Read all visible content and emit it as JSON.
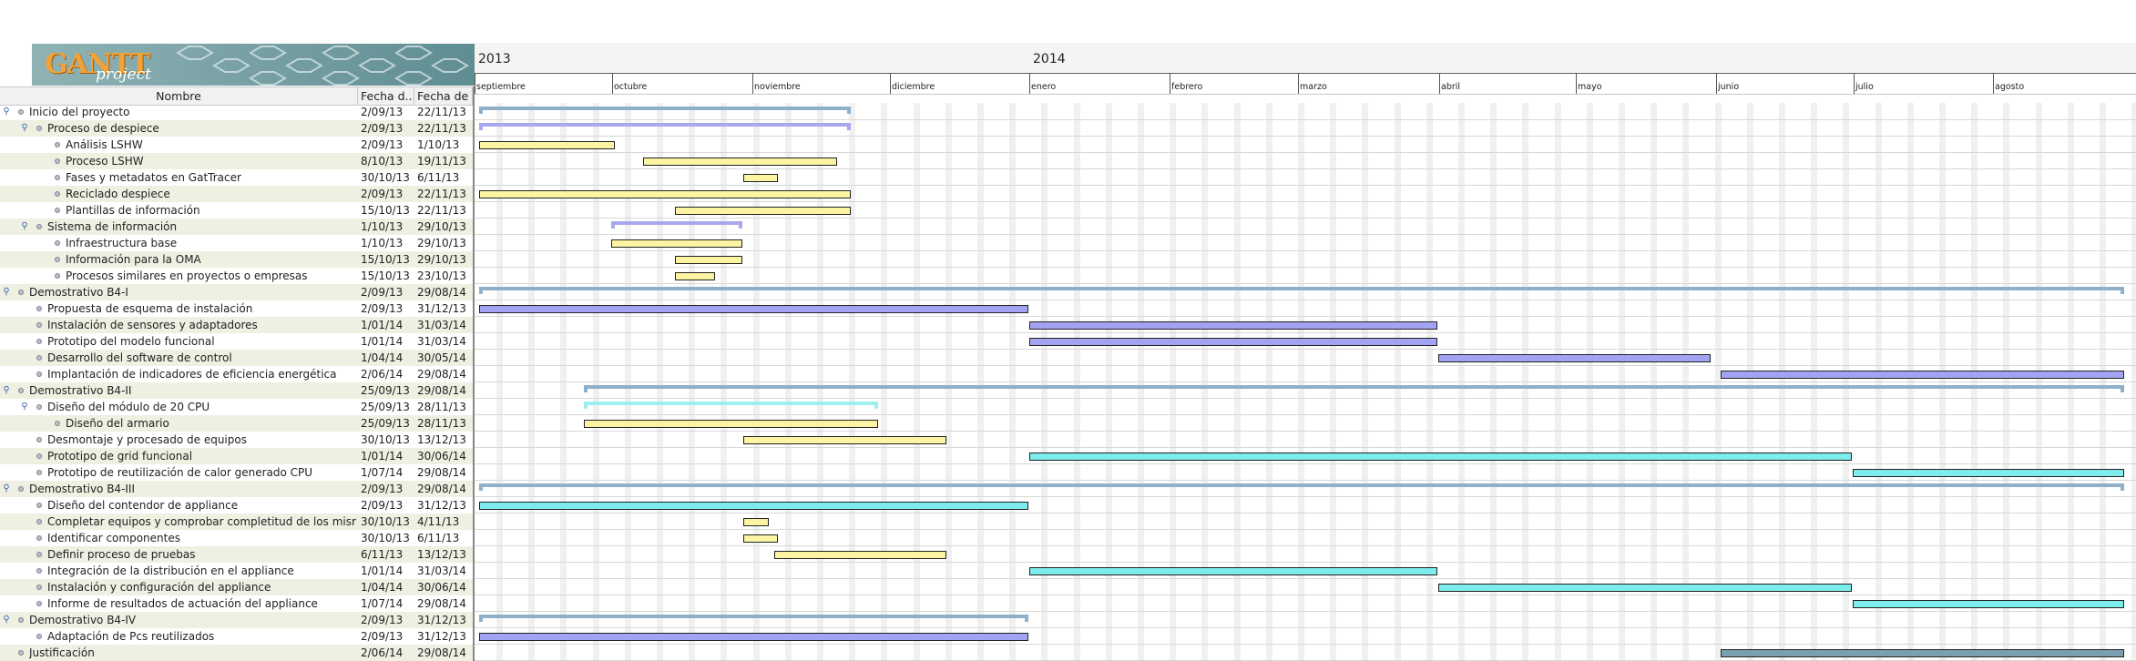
{
  "colors": {
    "yellow": "#fbf4a3",
    "purple": "#a3a3f4",
    "cyan": "#7cecec",
    "steel": "#7aa0b0",
    "summary_blue": "#8fb0c8",
    "summary_purple": "#a8a8ee",
    "summary_cyan": "#9ef0f0"
  },
  "logo": {
    "brand": "GANTT",
    "sub": "project"
  },
  "columns": {
    "name": "Nombre",
    "start": "Fecha d...",
    "end": "Fecha de ..."
  },
  "timeline": {
    "years": [
      "2013",
      "2014"
    ],
    "months": [
      "septiembre",
      "octubre",
      "noviembre",
      "diciembre",
      "enero",
      "febrero",
      "marzo",
      "abril",
      "mayo",
      "junio",
      "julio",
      "agosto"
    ]
  },
  "tasks": [
    {
      "name": "Inicio del proyecto",
      "start": "2/09/13",
      "end": "22/11/13",
      "level": 0,
      "expanded": true
    },
    {
      "name": "Proceso de despiece",
      "start": "2/09/13",
      "end": "22/11/13",
      "level": 1,
      "expanded": true
    },
    {
      "name": "Análisis LSHW",
      "start": "2/09/13",
      "end": "1/10/13",
      "level": 2
    },
    {
      "name": "Proceso LSHW",
      "start": "8/10/13",
      "end": "19/11/13",
      "level": 2
    },
    {
      "name": "Fases y metadatos en GatTracer",
      "start": "30/10/13",
      "end": "6/11/13",
      "level": 2
    },
    {
      "name": "Reciclado despiece",
      "start": "2/09/13",
      "end": "22/11/13",
      "level": 2
    },
    {
      "name": "Plantillas de información",
      "start": "15/10/13",
      "end": "22/11/13",
      "level": 2
    },
    {
      "name": "Sistema de información",
      "start": "1/10/13",
      "end": "29/10/13",
      "level": 1,
      "expanded": true
    },
    {
      "name": "Infraestructura base",
      "start": "1/10/13",
      "end": "29/10/13",
      "level": 2
    },
    {
      "name": "Información para la OMA",
      "start": "15/10/13",
      "end": "29/10/13",
      "level": 2
    },
    {
      "name": "Procesos similares en proyectos o empresas",
      "start": "15/10/13",
      "end": "23/10/13",
      "level": 2
    },
    {
      "name": "Demostrativo B4-I",
      "start": "2/09/13",
      "end": "29/08/14",
      "level": 0,
      "expanded": true
    },
    {
      "name": "Propuesta de esquema de instalación",
      "start": "2/09/13",
      "end": "31/12/13",
      "level": 1
    },
    {
      "name": "Instalación de sensores y adaptadores",
      "start": "1/01/14",
      "end": "31/03/14",
      "level": 1
    },
    {
      "name": "Prototipo del modelo funcional",
      "start": "1/01/14",
      "end": "31/03/14",
      "level": 1
    },
    {
      "name": "Desarrollo del software de control",
      "start": "1/04/14",
      "end": "30/05/14",
      "level": 1
    },
    {
      "name": "Implantación de indicadores de eficiencia energética",
      "start": "2/06/14",
      "end": "29/08/14",
      "level": 1
    },
    {
      "name": "Demostrativo B4-II",
      "start": "25/09/13",
      "end": "29/08/14",
      "level": 0,
      "expanded": true
    },
    {
      "name": "Diseño del módulo de 20 CPU",
      "start": "25/09/13",
      "end": "28/11/13",
      "level": 1,
      "expanded": true
    },
    {
      "name": "Diseño del armario",
      "start": "25/09/13",
      "end": "28/11/13",
      "level": 2
    },
    {
      "name": "Desmontaje y procesado de equipos",
      "start": "30/10/13",
      "end": "13/12/13",
      "level": 1
    },
    {
      "name": "Prototipo de grid funcional",
      "start": "1/01/14",
      "end": "30/06/14",
      "level": 1
    },
    {
      "name": "Prototipo de reutilización de calor generado CPU",
      "start": "1/07/14",
      "end": "29/08/14",
      "level": 1
    },
    {
      "name": "Demostrativo B4-III",
      "start": "2/09/13",
      "end": "29/08/14",
      "level": 0,
      "expanded": true
    },
    {
      "name": "Diseño del contendor de appliance",
      "start": "2/09/13",
      "end": "31/12/13",
      "level": 1
    },
    {
      "name": "Completar equipos y comprobar completitud de los mismos",
      "start": "30/10/13",
      "end": "4/11/13",
      "level": 1
    },
    {
      "name": "Identificar componentes",
      "start": "30/10/13",
      "end": "6/11/13",
      "level": 1
    },
    {
      "name": "Definir proceso de pruebas",
      "start": "6/11/13",
      "end": "13/12/13",
      "level": 1
    },
    {
      "name": "Integración de la distribución en el appliance",
      "start": "1/01/14",
      "end": "31/03/14",
      "level": 1
    },
    {
      "name": "Instalación y configuración del appliance",
      "start": "1/04/14",
      "end": "30/06/14",
      "level": 1
    },
    {
      "name": "Informe de resultados de actuación del appliance",
      "start": "1/07/14",
      "end": "29/08/14",
      "level": 1
    },
    {
      "name": "Demostrativo B4-IV",
      "start": "2/09/13",
      "end": "31/12/13",
      "level": 0,
      "expanded": true
    },
    {
      "name": "Adaptación de Pcs reutilizados",
      "start": "2/09/13",
      "end": "31/12/13",
      "level": 1
    },
    {
      "name": "Justificación",
      "start": "2/06/14",
      "end": "29/08/14",
      "level": 0
    }
  ]
}
